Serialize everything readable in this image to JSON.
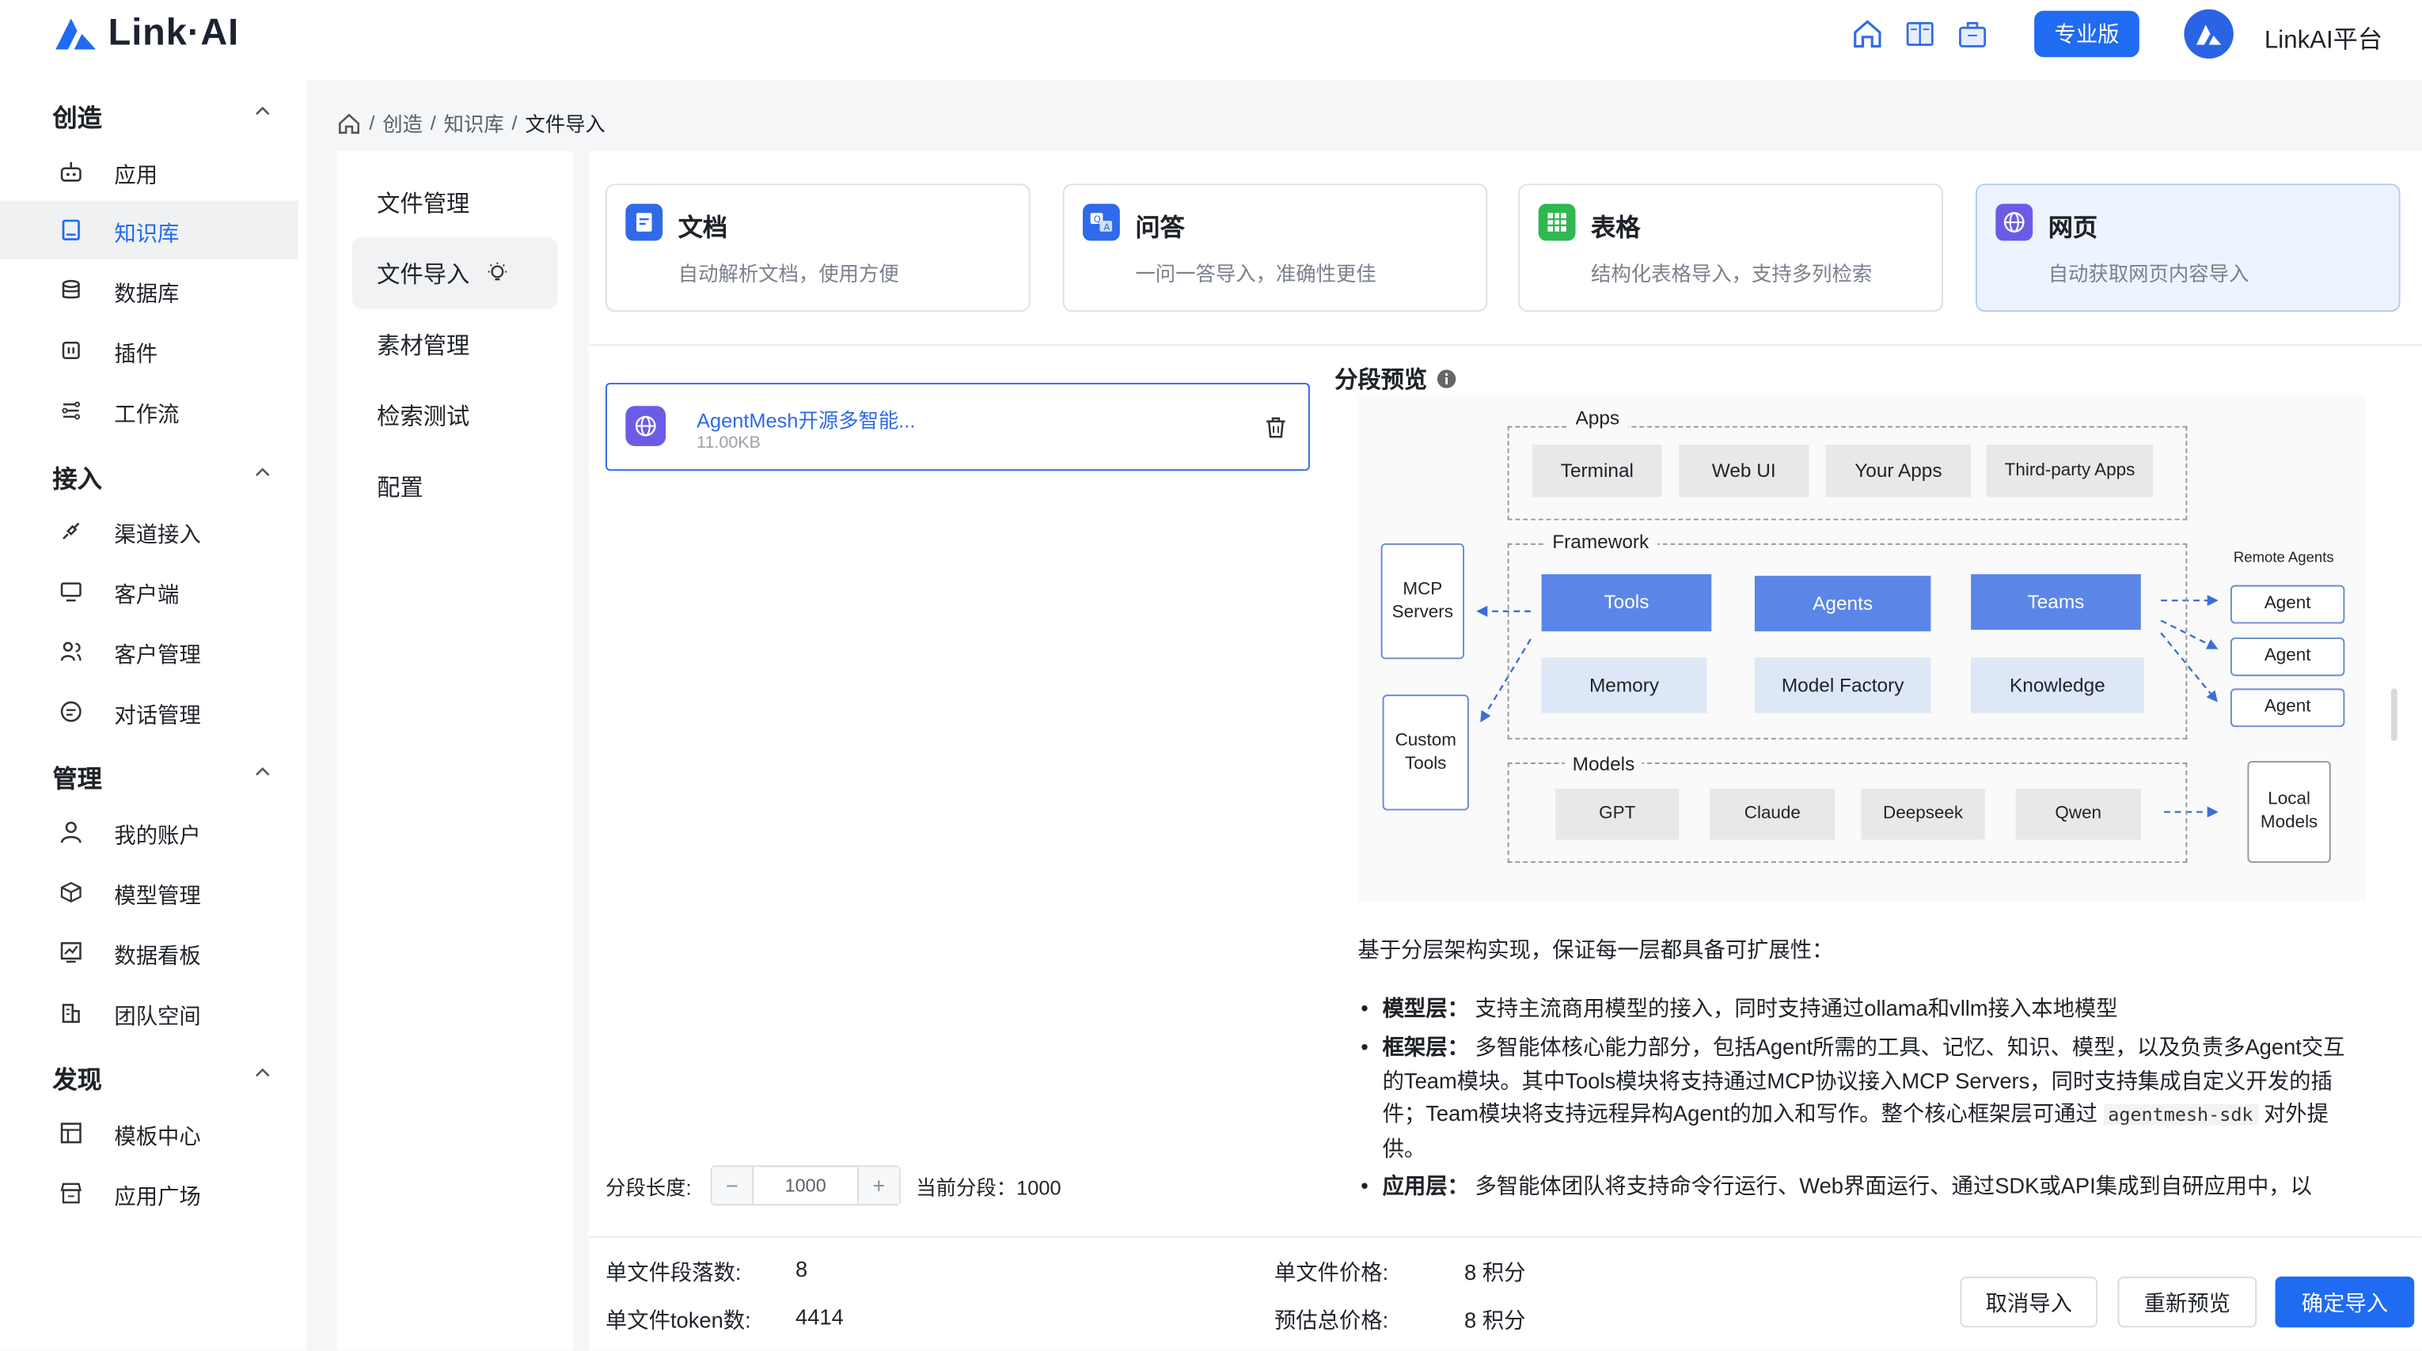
{
  "app": {
    "logo_text": "Link·AI",
    "pro_label": "专业版",
    "platform_label": "LinkAI平台"
  },
  "header_icons": [
    "home-icon",
    "book-icon",
    "briefcase-icon"
  ],
  "sidebar": {
    "sections": [
      {
        "title": "创造",
        "items": [
          {
            "label": "应用",
            "icon": "robot-icon"
          },
          {
            "label": "知识库",
            "icon": "book-icon",
            "active": true
          },
          {
            "label": "数据库",
            "icon": "database-icon"
          },
          {
            "label": "插件",
            "icon": "plugin-icon"
          },
          {
            "label": "工作流",
            "icon": "workflow-icon"
          }
        ]
      },
      {
        "title": "接入",
        "items": [
          {
            "label": "渠道接入",
            "icon": "plug-icon"
          },
          {
            "label": "客户端",
            "icon": "monitor-icon"
          },
          {
            "label": "客户管理",
            "icon": "users-icon"
          },
          {
            "label": "对话管理",
            "icon": "chat-icon"
          }
        ]
      },
      {
        "title": "管理",
        "items": [
          {
            "label": "我的账户",
            "icon": "user-icon"
          },
          {
            "label": "模型管理",
            "icon": "cube-icon"
          },
          {
            "label": "数据看板",
            "icon": "chart-icon"
          },
          {
            "label": "团队空间",
            "icon": "building-icon"
          }
        ]
      },
      {
        "title": "发现",
        "items": [
          {
            "label": "模板中心",
            "icon": "template-icon"
          },
          {
            "label": "应用广场",
            "icon": "store-icon"
          }
        ]
      }
    ]
  },
  "breadcrumb": {
    "items": [
      "创造",
      "知识库"
    ],
    "current": "文件导入"
  },
  "submenu": {
    "items": [
      "文件管理",
      "文件导入",
      "素材管理",
      "检索测试",
      "配置"
    ],
    "active_index": 1
  },
  "import_types": [
    {
      "title": "文档",
      "desc": "自动解析文档，使用方便",
      "color": "#2f6ae8",
      "icon": "document-icon"
    },
    {
      "title": "问答",
      "desc": "一问一答导入，准确性更佳",
      "color": "#2f6ae8",
      "icon": "qa-icon"
    },
    {
      "title": "表格",
      "desc": "结构化表格导入，支持多列检索",
      "color": "#2fb84f",
      "icon": "table-icon"
    },
    {
      "title": "网页",
      "desc": "自动获取网页内容导入",
      "color": "#6b5ce7",
      "icon": "globe-icon",
      "selected": true
    }
  ],
  "file": {
    "name": "AgentMesh开源多智能...",
    "size": "11.00KB"
  },
  "preview": {
    "title": "分段预览",
    "diagram": {
      "apps_label": "Apps",
      "apps": [
        "Terminal",
        "Web UI",
        "Your Apps",
        "Third-party Apps"
      ],
      "framework_label": "Framework",
      "framework_top": [
        "Tools",
        "Agents",
        "Teams"
      ],
      "framework_bottom": [
        "Memory",
        "Model Factory",
        "Knowledge"
      ],
      "mcp": "MCP Servers",
      "custom_tools": "Custom Tools",
      "remote_label": "Remote Agents",
      "remote_agents": [
        "Agent",
        "Agent",
        "Agent"
      ],
      "models_label": "Models",
      "models": [
        "GPT",
        "Claude",
        "Deepseek",
        "Qwen"
      ],
      "local_models": "Local Models"
    },
    "intro": "基于分层架构实现，保证每一层都具备可扩展性：",
    "bullets": [
      {
        "term": "模型层：",
        "text": "支持主流商用模型的接入，同时支持通过ollama和vllm接入本地模型"
      },
      {
        "term": "框架层：",
        "text": "多智能体核心能力部分，包括Agent所需的工具、记忆、知识、模型，以及负责多Agent交互的Team模块。其中Tools模块将支持通过MCP协议接入MCP Servers，同时支持集成自定义开发的插件；Team模块将支持远程异构Agent的加入和写作。整个核心框架层可通过",
        "code": "agentmesh-sdk",
        "tail": "对外提供。"
      },
      {
        "term": "应用层：",
        "text": "多智能体团队将支持命令行运行、Web界面运行、通过SDK或API集成到自研应用中，以"
      }
    ]
  },
  "segment": {
    "length_label": "分段长度:",
    "length_value": "1000",
    "current_label": "当前分段：",
    "current_value": "1000"
  },
  "stats": {
    "seg_count_label": "单文件段落数:",
    "seg_count": "8",
    "token_label": "单文件token数:",
    "token_count": "4414",
    "price_label": "单文件价格:",
    "price": "8 积分",
    "total_label": "预估总价格:",
    "total": "8 积分"
  },
  "buttons": {
    "cancel": "取消导入",
    "repreview": "重新预览",
    "confirm": "确定导入"
  },
  "colors": {
    "accent": "#1f6bf2",
    "diagram_blue": "#5b86e8"
  }
}
